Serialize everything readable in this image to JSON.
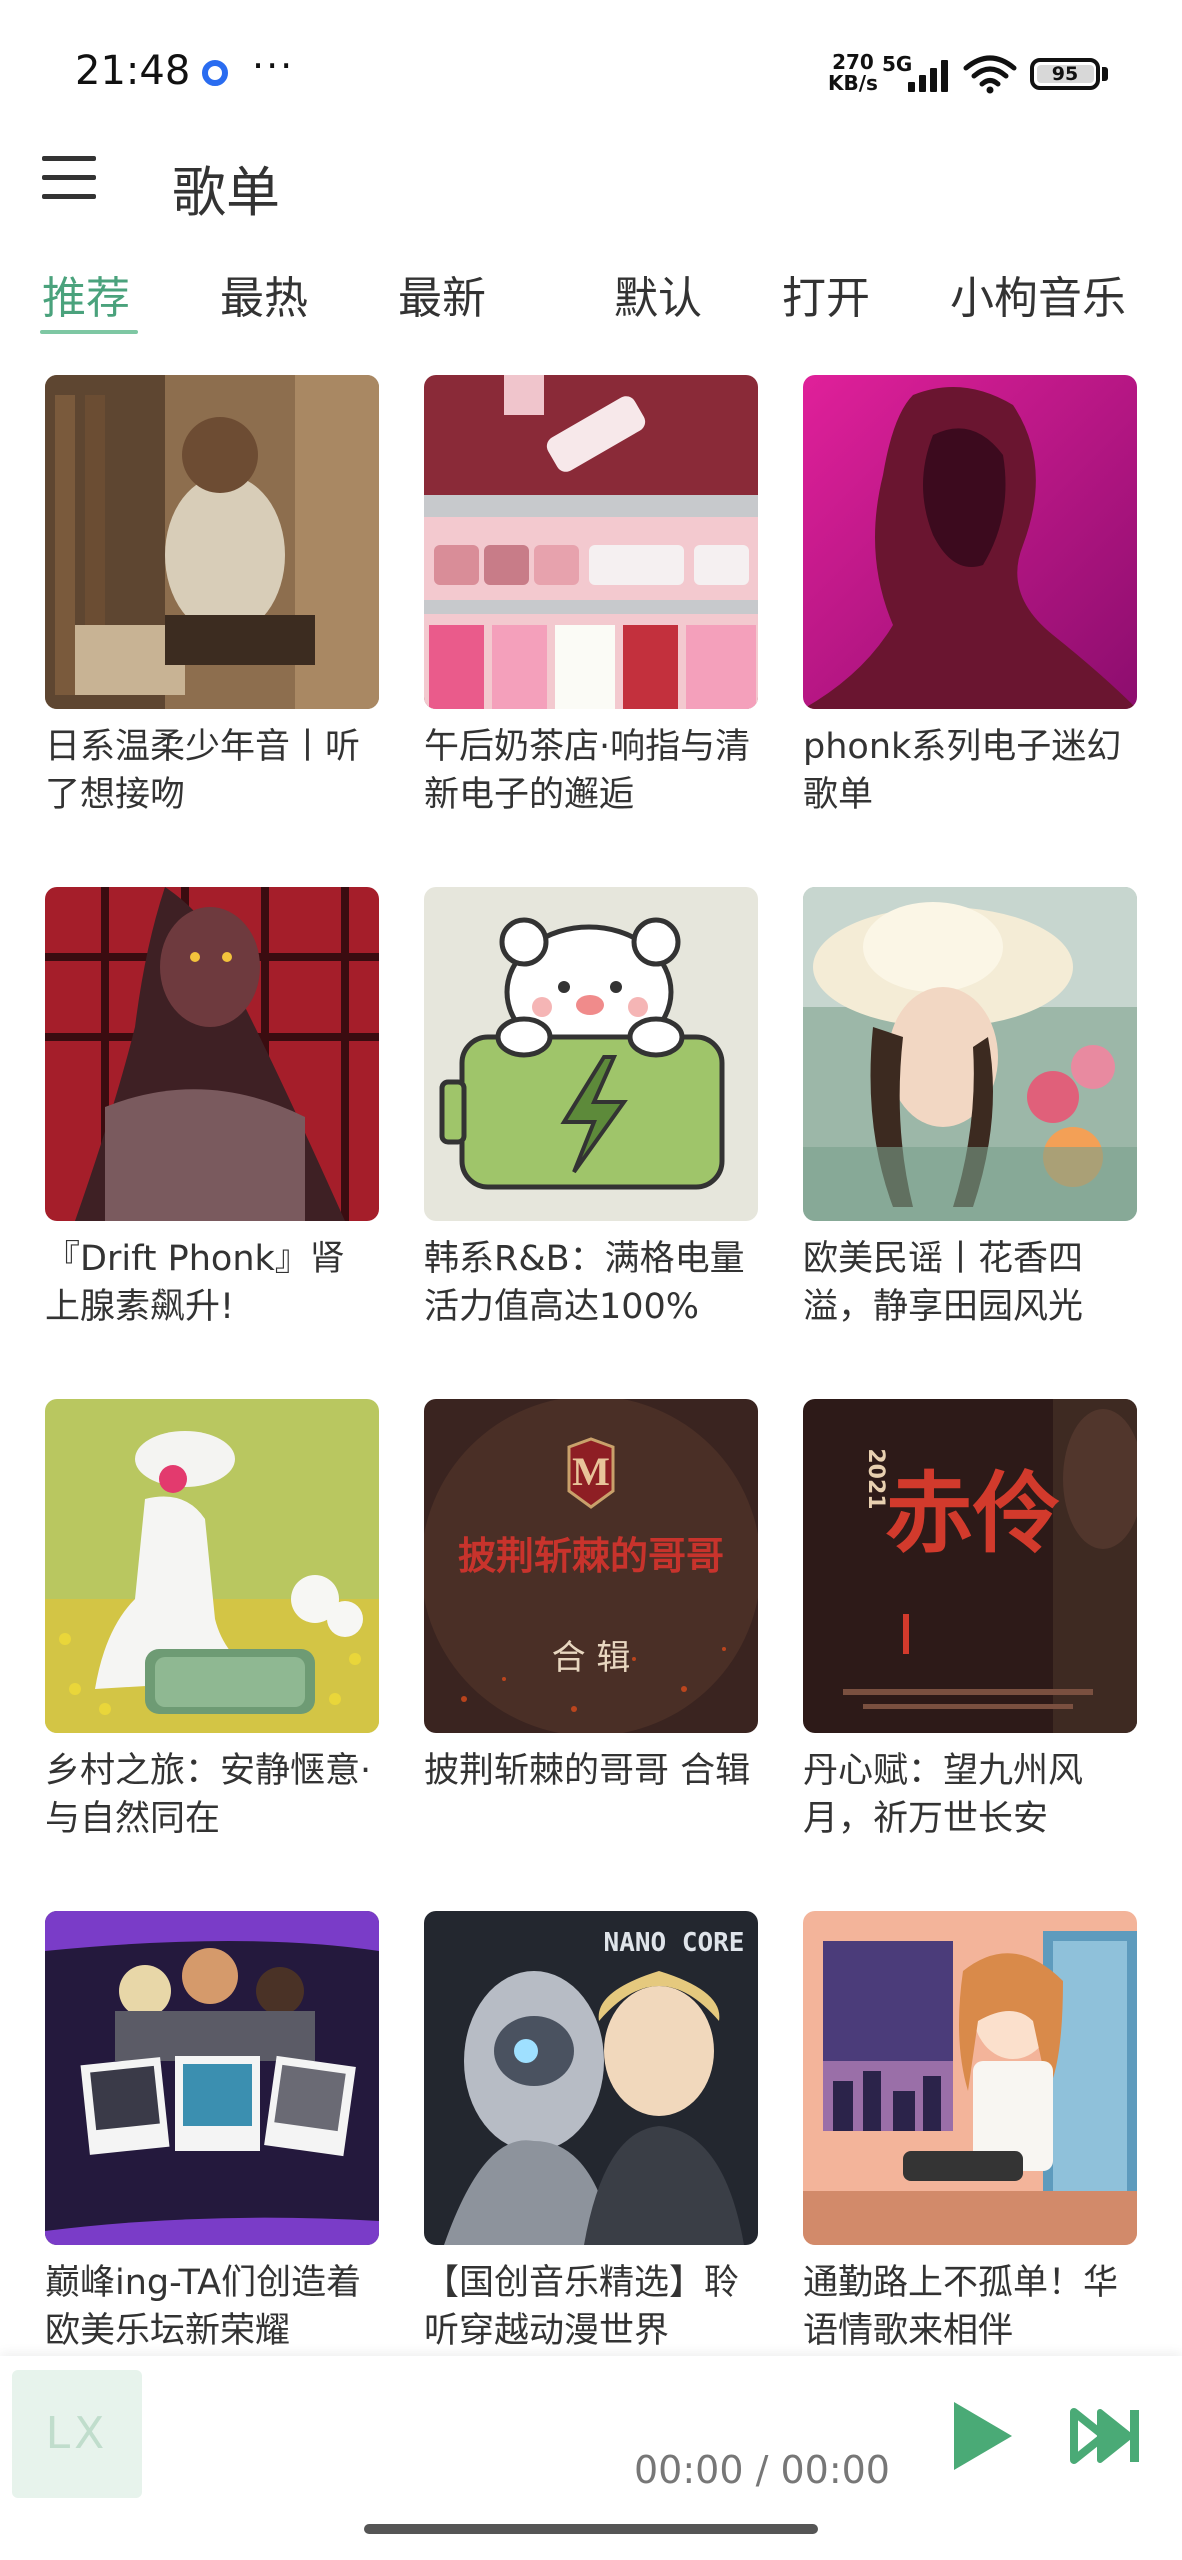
{
  "status_bar": {
    "time": "21:48",
    "network_speed_value": "270",
    "network_speed_unit": "KB/s",
    "network_type": "5G",
    "battery_level": "95",
    "icons": [
      "app-notification-icon",
      "more-dots-icon",
      "signal-icon",
      "wifi-icon",
      "battery-icon"
    ]
  },
  "header": {
    "title": "歌单",
    "menu_icon": "hamburger-menu-icon"
  },
  "tabs": [
    {
      "label": "推荐",
      "active": true
    },
    {
      "label": "最热",
      "active": false
    },
    {
      "label": "最新",
      "active": false
    },
    {
      "label": "默认",
      "active": false
    },
    {
      "label": "打开",
      "active": false
    },
    {
      "label": "小枸音乐",
      "active": false
    }
  ],
  "playlists": [
    {
      "title": "日系温柔少年音丨听了想接吻"
    },
    {
      "title": "午后奶茶店·响指与清新电子的邂逅"
    },
    {
      "title": "phonk系列电子迷幻歌单"
    },
    {
      "title": "『Drift Phonk』肾上腺素飙升!"
    },
    {
      "title": "韩系R&B：满格电量 活力值高达100%"
    },
    {
      "title": "欧美民谣丨花香四溢，静享田园风光"
    },
    {
      "title": "乡村之旅：安静惬意·与自然同在"
    },
    {
      "title": "披荆斩棘的哥哥 合辑"
    },
    {
      "title": "丹心赋：望九州风月，祈万世长安"
    },
    {
      "title": "巅峰ing-TA们创造着欧美乐坛新荣耀"
    },
    {
      "title": "【国创音乐精选】聆听穿越动漫世界"
    },
    {
      "title": "通勤路上不孤单！华语情歌来相伴"
    }
  ],
  "cover_text": {
    "brothers_title": "披荆斩棘的哥哥",
    "brothers_sub": "合 辑",
    "chixin_title": "赤伶",
    "chixin_year": "2021",
    "nano_core": "NANO CORE"
  },
  "player": {
    "logo": "LX",
    "time": "00:00 / 00:00",
    "play_icon": "play-icon",
    "next_icon": "skip-next-icon"
  },
  "colors": {
    "accent": "#4aa27c",
    "tab_underline": "#7ec7a3",
    "player_button": "#4aaa76"
  }
}
